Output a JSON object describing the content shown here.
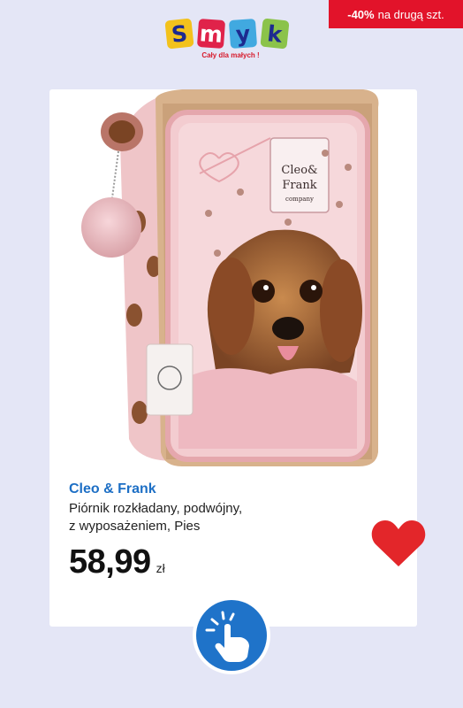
{
  "promo": {
    "percent": "-40%",
    "text": "na drugą szt."
  },
  "logo": {
    "letters": [
      "S",
      "m",
      "y",
      "k"
    ],
    "colors": [
      "#f3c21c",
      "#e0234a",
      "#41a9e0",
      "#8bc34a"
    ],
    "tagline": "Cały dla małych !"
  },
  "product": {
    "image_logo_line1": "Cleo&",
    "image_logo_line2": "Frank",
    "image_logo_line3": "company",
    "brand": "Cleo & Frank",
    "description_line1": "Piórnik rozkładany, podwójny,",
    "description_line2": "z wyposażeniem, Pies",
    "price": "58,99",
    "currency": "zł"
  },
  "colors": {
    "promo_bg": "#e2132a",
    "brand_blue": "#1d6fc5",
    "heart_red": "#e3262a",
    "page_bg": "#e4e6f6",
    "tap_button": "#1f73c9"
  },
  "icons": {
    "wishlist": "heart-icon",
    "tap": "tap-hand-icon"
  }
}
